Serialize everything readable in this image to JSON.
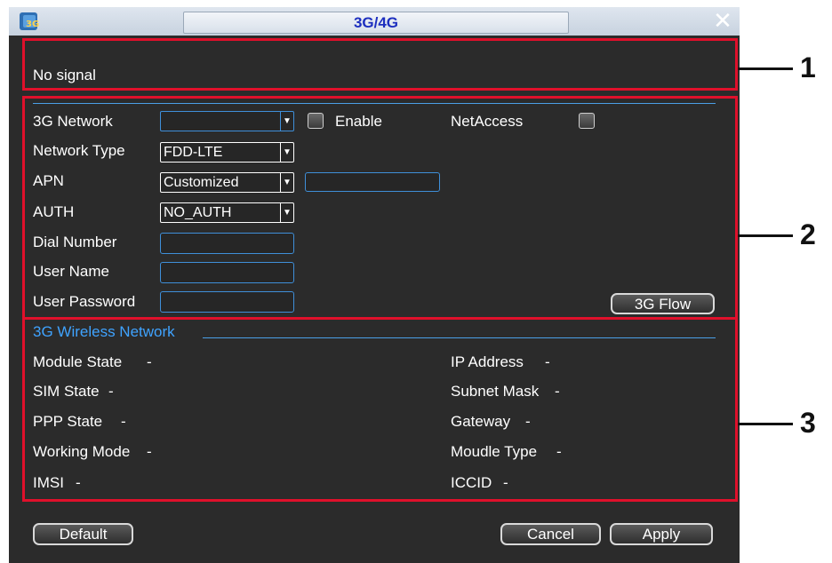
{
  "window": {
    "title": "3G/4G",
    "close_glyph": "✕"
  },
  "signal": {
    "status": "No signal"
  },
  "settings": {
    "network_label": "3G Network",
    "network_value": "",
    "enable_label": "Enable",
    "netaccess_label": "NetAccess",
    "network_type_label": "Network Type",
    "network_type_value": "FDD-LTE",
    "apn_label": "APN",
    "apn_value": "Customized",
    "apn_custom_value": "",
    "auth_label": "AUTH",
    "auth_value": "NO_AUTH",
    "dial_label": "Dial Number",
    "dial_value": "",
    "user_label": "User Name",
    "user_value": "",
    "password_label": "User Password",
    "password_value": "",
    "flow_button": "3G Flow"
  },
  "wireless": {
    "section_title": "3G Wireless Network",
    "left": [
      {
        "label": "Module State",
        "value": "-"
      },
      {
        "label": "SIM State",
        "value": "-"
      },
      {
        "label": "PPP State",
        "value": "-"
      },
      {
        "label": "Working Mode",
        "value": "-"
      },
      {
        "label": "IMSI",
        "value": "-"
      }
    ],
    "right": [
      {
        "label": "IP Address",
        "value": "-"
      },
      {
        "label": "Subnet Mask",
        "value": "-"
      },
      {
        "label": "Gateway",
        "value": "-"
      },
      {
        "label": "Moudle Type",
        "value": "-"
      },
      {
        "label": "ICCID",
        "value": "-"
      }
    ]
  },
  "footer": {
    "default_button": "Default",
    "cancel_button": "Cancel",
    "apply_button": "Apply"
  },
  "callouts": [
    "1",
    "2",
    "3"
  ],
  "colors": {
    "annotation_red": "#e0102b",
    "accent_blue": "#3f8fd9",
    "panel_bg": "#2b2b2b"
  }
}
